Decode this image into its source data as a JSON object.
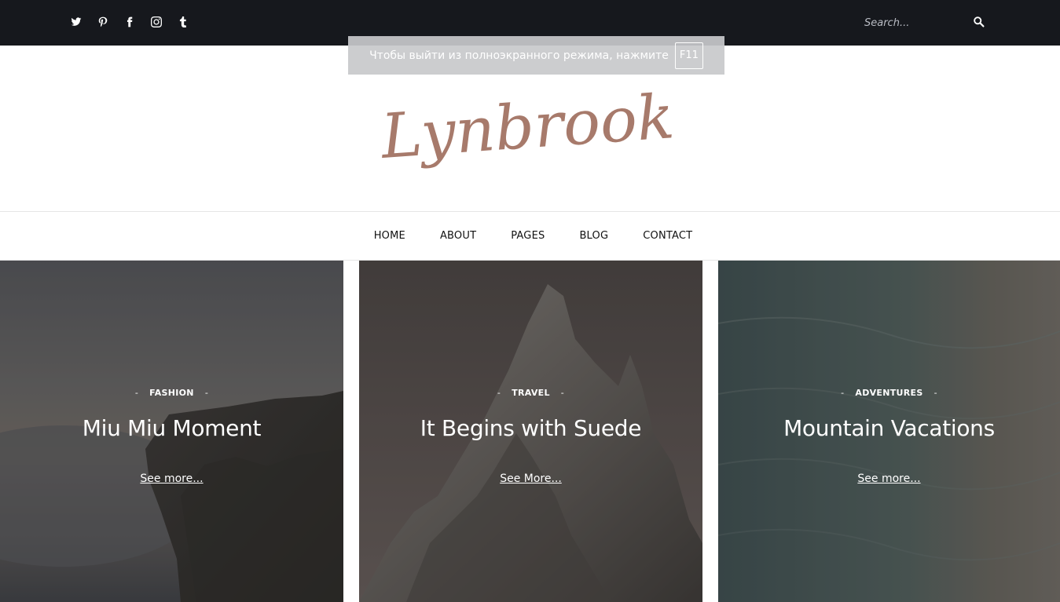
{
  "topbar": {
    "social_icons": [
      "twitter-icon",
      "pinterest-icon",
      "facebook-icon",
      "instagram-icon",
      "tumblr-icon"
    ],
    "search": {
      "placeholder": "Search...",
      "value": ""
    },
    "background": "#16181d"
  },
  "fullscreen_notice": {
    "message": "Чтобы выйти из полноэкранного режима, нажмите",
    "key": "F11"
  },
  "site": {
    "logo_text": "Lynbrook",
    "logo_color": "#a77a6b"
  },
  "nav": {
    "items": [
      {
        "label": "HOME"
      },
      {
        "label": "ABOUT"
      },
      {
        "label": "PAGES"
      },
      {
        "label": "BLOG"
      },
      {
        "label": "CONTACT"
      }
    ]
  },
  "cards": [
    {
      "category": "FASHION",
      "title": "Miu Miu Moment",
      "link_label": "See more..."
    },
    {
      "category": "TRAVEL",
      "title": "It Begins with Suede",
      "link_label": "See More..."
    },
    {
      "category": "ADVENTURES",
      "title": "Mountain Vacations",
      "link_label": "See more..."
    }
  ]
}
